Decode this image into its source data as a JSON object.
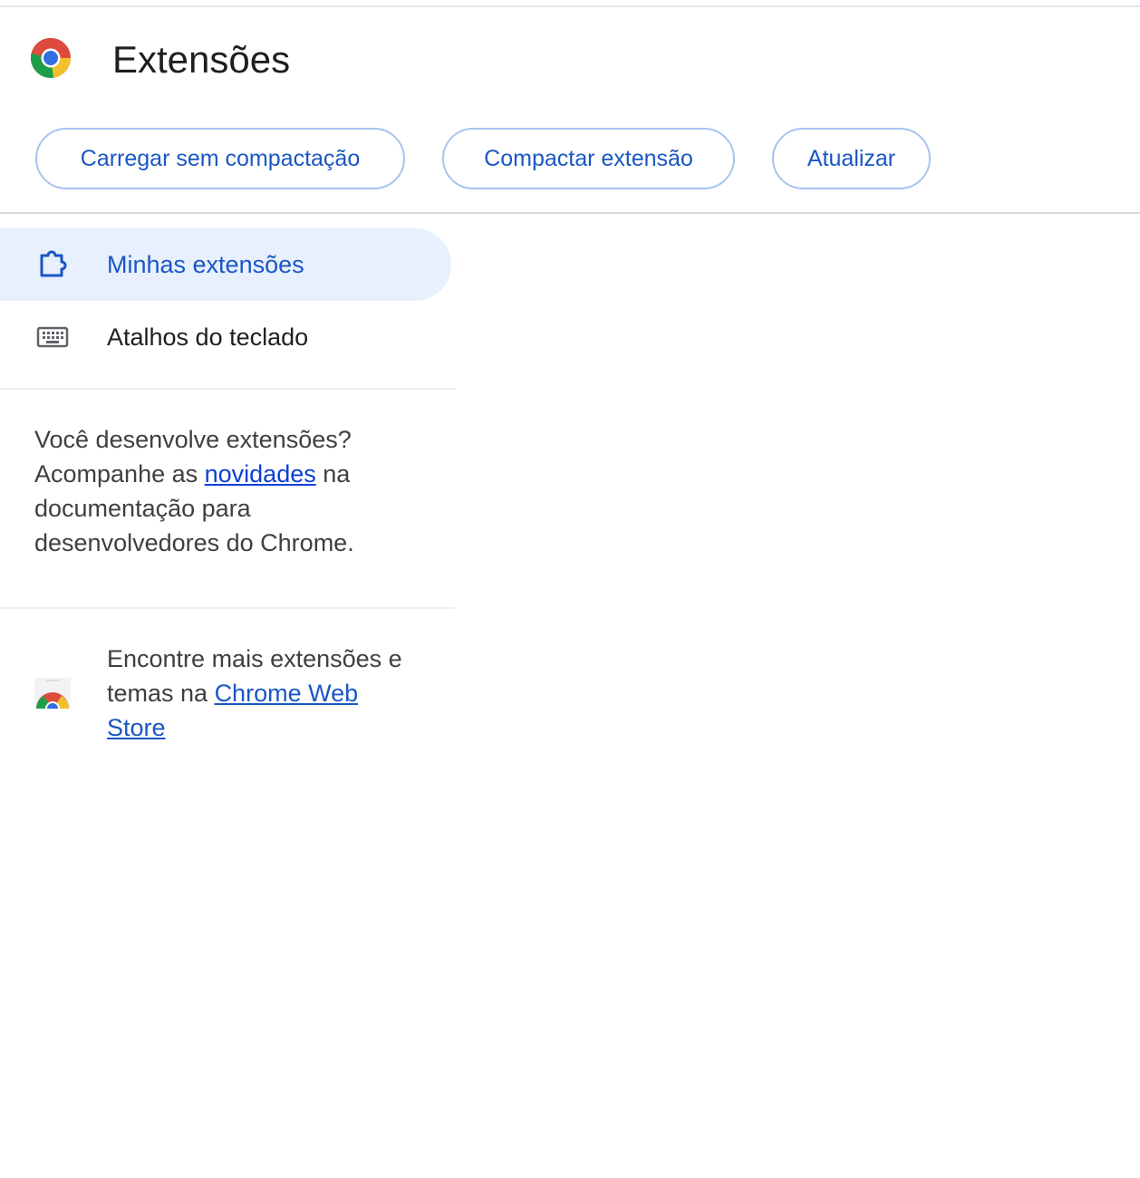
{
  "header": {
    "title": "Extensões",
    "logo_icon": "chrome-logo-icon"
  },
  "toolbar": {
    "load_unpacked_label": "Carregar sem compactação",
    "pack_extension_label": "Compactar extensão",
    "update_label": "Atualizar"
  },
  "sidebar": {
    "items": [
      {
        "label": "Minhas extensões",
        "icon": "puzzle-piece-icon",
        "active": true
      },
      {
        "label": "Atalhos do teclado",
        "icon": "keyboard-icon",
        "active": false
      }
    ]
  },
  "developer_promo": {
    "text_before": "Você desenvolve extensões? Acompanhe as ",
    "link_text": "novidades",
    "text_after": " na documentação para desenvolvedores do Chrome."
  },
  "webstore_promo": {
    "icon": "chrome-web-store-icon",
    "text_before": "Encontre mais extensões e temas na ",
    "link_text": "Chrome Web Store"
  },
  "colors": {
    "accent": "#1a56c4",
    "active_nav_bg": "#e8effd",
    "button_border": "#a8c3f0",
    "link_blue": "#0b3fd6"
  }
}
